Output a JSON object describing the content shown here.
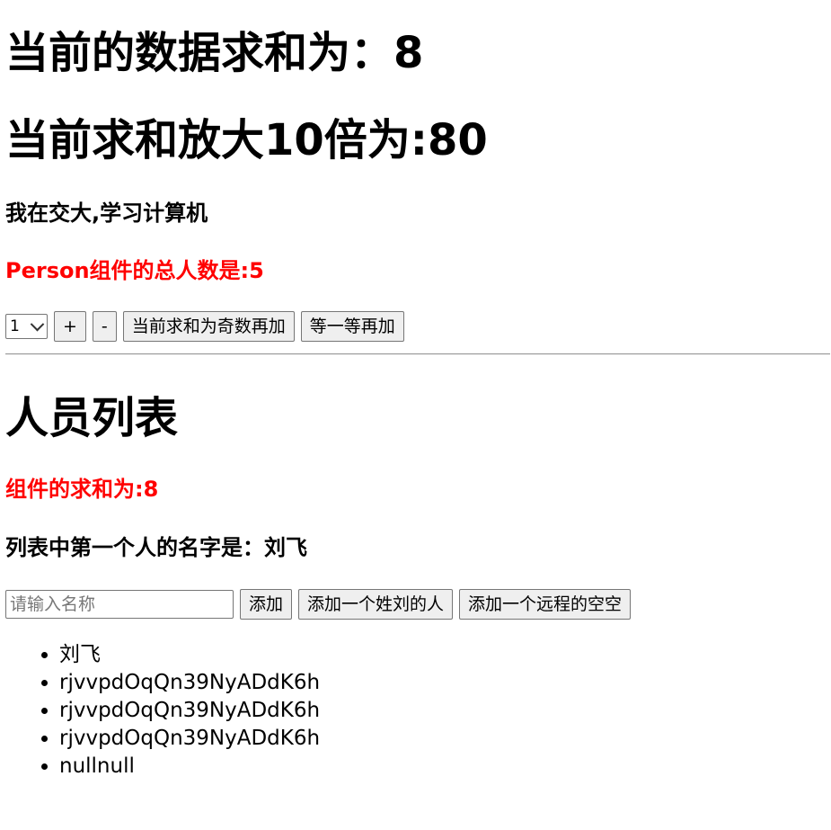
{
  "count": {
    "sum_text": "当前的数据求和为：8",
    "x10_text": "当前求和放大10倍为:80",
    "school_text": "我在交大,学习计算机",
    "person_count_text": "Person组件的总人数是:5"
  },
  "toolbar": {
    "select_value": "1",
    "plus_label": "+",
    "minus_label": "-",
    "odd_add_label": "当前求和为奇数再加",
    "wait_add_label": "等一等再加"
  },
  "person": {
    "title": "人员列表",
    "component_sum_text": "组件的求和为:8",
    "first_person_text": "列表中第一个人的名字是：刘飞",
    "input_placeholder": "请输入名称",
    "input_value": "",
    "add_label": "添加",
    "add_wang_label": "添加一个姓刘的人",
    "add_remote_label": "添加一个远程的空空",
    "list": [
      "刘飞",
      "rjvvpdOqQn39NyADdK6h",
      "rjvvpdOqQn39NyADdK6h",
      "rjvvpdOqQn39NyADdK6h",
      "nullnull"
    ]
  },
  "colors": {
    "accent_red": "#ff0000",
    "text": "#000000",
    "button_bg": "#efefef"
  }
}
